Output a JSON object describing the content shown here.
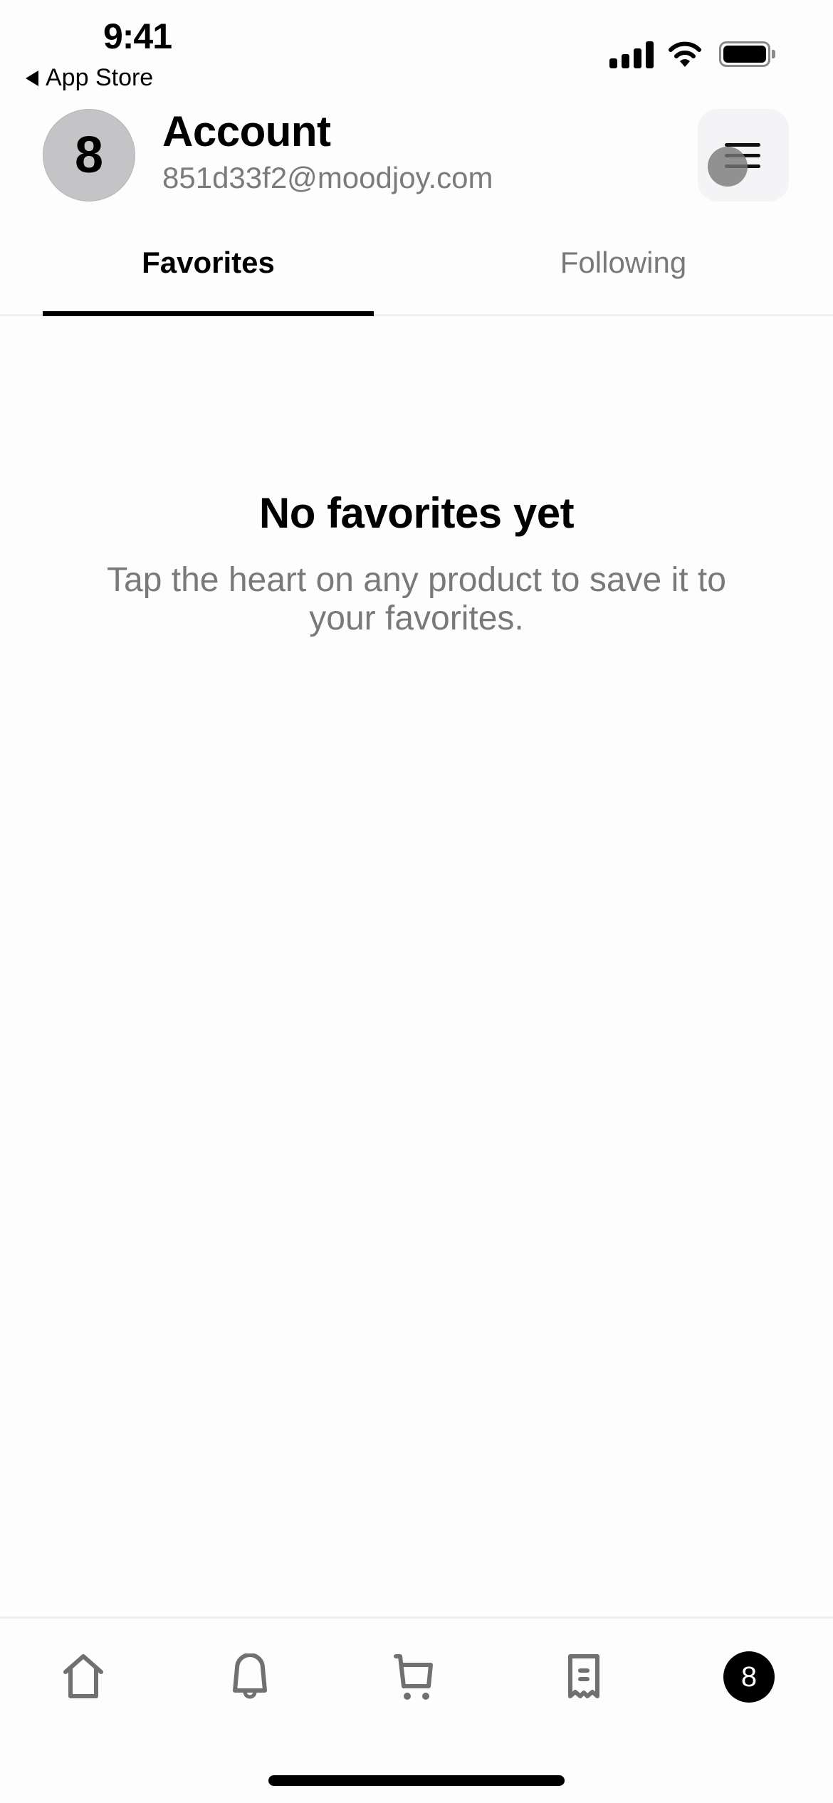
{
  "status_bar": {
    "time": "9:41",
    "back_app_label": "App Store",
    "signal_bars": 4,
    "battery_percent": 100
  },
  "header": {
    "avatar_initial": "8",
    "title": "Account",
    "email": "851d33f2@moodjoy.com",
    "menu_icon": "hamburger-menu-icon"
  },
  "tabs": [
    {
      "label": "Favorites",
      "active": true
    },
    {
      "label": "Following",
      "active": false
    }
  ],
  "empty_state": {
    "title": "No favorites yet",
    "message": "Tap the heart on any product to save it to your favorites."
  },
  "bottom_nav": {
    "items": [
      {
        "name": "home",
        "icon": "home-icon"
      },
      {
        "name": "notifications",
        "icon": "bell-icon"
      },
      {
        "name": "cart",
        "icon": "cart-icon"
      },
      {
        "name": "orders",
        "icon": "receipt-icon"
      },
      {
        "name": "profile",
        "icon": "profile-avatar",
        "label": "8",
        "active": true
      }
    ]
  },
  "colors": {
    "text_primary": "#000000",
    "text_secondary": "#79787b",
    "avatar_bg": "#c4c3c6",
    "menu_button_bg": "#f4f3f5",
    "divider": "#efeef0",
    "icon_gray": "#707072"
  }
}
